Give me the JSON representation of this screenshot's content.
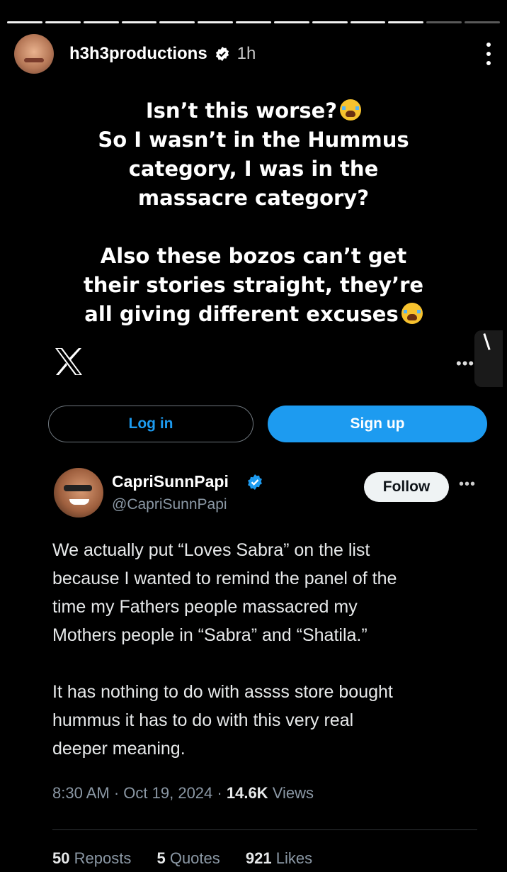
{
  "story": {
    "username": "h3h3productions",
    "time": "1h",
    "caption_lines_1": [
      "Isn’t this worse?",
      "So I wasn’t in the Hummus",
      "category, I was in the",
      "massacre category?"
    ],
    "caption_lines_2": [
      "Also these bozos can’t get",
      "their stories straight, they’re",
      "all giving different excuses"
    ],
    "emoji_icon": "loudly-crying-face-icon"
  },
  "x_embed": {
    "login_label": "Log in",
    "signup_label": "Sign up",
    "brand_color": "#1d9bf0"
  },
  "tweet": {
    "author_name": "CapriSunnPapi",
    "author_handle": "@CapriSunnPapi",
    "follow_label": "Follow",
    "paragraph_1": [
      "We actually put “Loves Sabra” on the list",
      "because I wanted to remind the panel of the",
      "time my Fathers people massacred my",
      "Mothers people in “Sabra” and “Shatila.”"
    ],
    "paragraph_2": [
      "It has nothing to do with assss store bought",
      "hummus it has to do with this very real",
      "deeper meaning."
    ],
    "time": "8:30 AM",
    "date": "Oct 19, 2024",
    "views_count": "14.6K",
    "views_label": "Views",
    "reposts_count": "50",
    "reposts_label": "Reposts",
    "quotes_count": "5",
    "quotes_label": "Quotes",
    "likes_count": "921",
    "likes_label": "Likes"
  }
}
